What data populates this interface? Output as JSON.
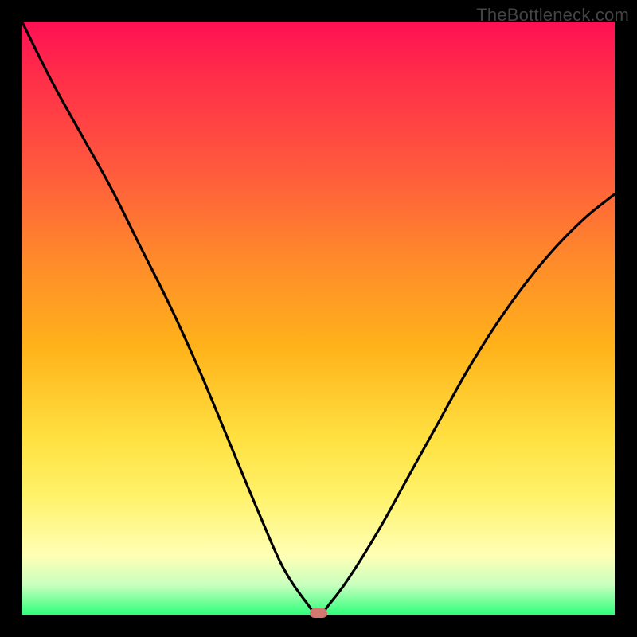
{
  "watermark": "TheBottleneck.com",
  "colors": {
    "curve": "#000000",
    "marker": "#d4776f",
    "frame": "#000000"
  },
  "chart_data": {
    "type": "line",
    "title": "",
    "xlabel": "",
    "ylabel": "",
    "xlim": [
      0,
      100
    ],
    "ylim": [
      0,
      100
    ],
    "grid": false,
    "legend": false,
    "note": "V-shaped bottleneck curve from TheBottleneck.com. Axis units not labeled in image; values are normalized 0–100. y≈100 means high bottleneck, y≈0 means none.",
    "series": [
      {
        "name": "bottleneck-curve",
        "x": [
          0,
          5,
          10,
          15,
          20,
          25,
          30,
          35,
          40,
          44,
          48,
          50,
          52,
          55,
          60,
          65,
          70,
          75,
          80,
          85,
          90,
          95,
          100
        ],
        "y": [
          100,
          90,
          81,
          72,
          62,
          52,
          41,
          29,
          17,
          8,
          2,
          0,
          2,
          6,
          14,
          23,
          32,
          41,
          49,
          56,
          62,
          67,
          71
        ]
      }
    ],
    "marker": {
      "x": 50,
      "y": 0
    }
  }
}
